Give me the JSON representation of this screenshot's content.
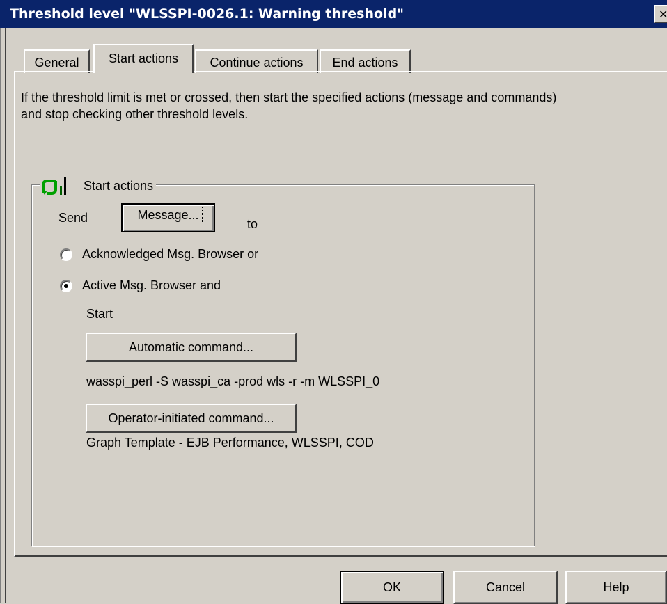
{
  "window": {
    "title": "Threshold level \"WLSSPI-0026.1: Warning threshold\"",
    "close_glyph": "✕"
  },
  "tabs": [
    {
      "label": "General",
      "active": false
    },
    {
      "label": "Start actions",
      "active": true
    },
    {
      "label": "Continue actions",
      "active": false
    },
    {
      "label": "End actions",
      "active": false
    }
  ],
  "description": "If the threshold limit is met or crossed, then start the specified actions (message and commands) and stop checking other threshold levels.",
  "group": {
    "title": "Start actions",
    "icon": "start-actions-arrow-icon",
    "icon_color": "#00a000",
    "send_label": "Send",
    "message_button": "Message...",
    "to_label": "to",
    "radio_acknowledged": "Acknowledged Msg. Browser or",
    "radio_active": "Active Msg. Browser and",
    "selected_radio": "active",
    "start_label": "Start",
    "automatic_command_button": "Automatic command...",
    "automatic_command_value": "wasspi_perl -S wasspi_ca -prod wls -r -m WLSSPI_0",
    "operator_command_button": "Operator-initiated command...",
    "operator_command_value": "Graph Template - EJB Performance, WLSSPI, COD"
  },
  "footer": {
    "ok": "OK",
    "cancel": "Cancel",
    "help": "Help"
  },
  "colors": {
    "titlebar": "#0a246a",
    "face": "#d4d0c8"
  }
}
